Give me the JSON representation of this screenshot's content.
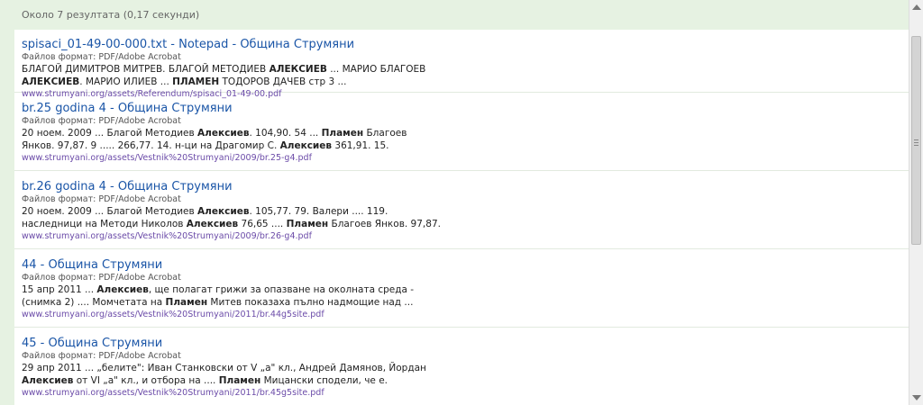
{
  "stats": "Около 7 резултата (0,17 секунди)",
  "results": [
    {
      "title": "spisaci_01-49-00-000.txt - Notepad - Община Струмяни",
      "format": "Файлов формат: PDF/Adobe Acrobat",
      "snippet_lines": [
        [
          {
            "t": "БЛАГОЙ ДИМИТРОВ МИТРЕВ. БЛАГОЙ МЕТОДИЕВ "
          },
          {
            "t": "АЛЕКСИЕВ",
            "b": true
          },
          {
            "t": " ... МАРИО БЛАГОЕВ"
          }
        ],
        [
          {
            "t": "АЛЕКСИЕВ",
            "b": true
          },
          {
            "t": ". МАРИО ИЛИЕВ ... "
          },
          {
            "t": "ПЛАМЕН",
            "b": true
          },
          {
            "t": " ТОДОРОВ ДАЧЕВ стр 3 ..."
          }
        ]
      ],
      "url": "www.strumyani.org/assets/Referendum/spisaci_01-49-00.pdf"
    },
    {
      "title": "br.25 godina 4 - Община Струмяни",
      "format": "Файлов формат: PDF/Adobe Acrobat",
      "snippet_lines": [
        [
          {
            "t": "20 ноем. 2009 ... Благой Методиев "
          },
          {
            "t": "Алексиев",
            "b": true
          },
          {
            "t": ". 104,90. 54 ... "
          },
          {
            "t": "Пламен",
            "b": true
          },
          {
            "t": " Благоев"
          }
        ],
        [
          {
            "t": "Янков. 97,87. 9 ..... 266,77. 14. н-ци на Драгомир С. "
          },
          {
            "t": "Алексиев",
            "b": true
          },
          {
            "t": " 361,91. 15."
          }
        ]
      ],
      "url": "www.strumyani.org/assets/Vestnik%20Strumyani/2009/br.25-g4.pdf"
    },
    {
      "title": "br.26 godina 4 - Община Струмяни",
      "format": "Файлов формат: PDF/Adobe Acrobat",
      "snippet_lines": [
        [
          {
            "t": "20 ноем. 2009 ... Благой Методиев "
          },
          {
            "t": "Алексиев",
            "b": true
          },
          {
            "t": ". 105,77. 79. Валери .... 119."
          }
        ],
        [
          {
            "t": "наследници на Методи Николов "
          },
          {
            "t": "Алексиев",
            "b": true
          },
          {
            "t": " 76,65 .... "
          },
          {
            "t": "Пламен",
            "b": true
          },
          {
            "t": " Благоев Янков. 97,87."
          }
        ]
      ],
      "url": "www.strumyani.org/assets/Vestnik%20Strumyani/2009/br.26-g4.pdf"
    },
    {
      "title": "44 - Община Струмяни",
      "format": "Файлов формат: PDF/Adobe Acrobat",
      "snippet_lines": [
        [
          {
            "t": "15 апр 2011 ... "
          },
          {
            "t": "Алексиев",
            "b": true
          },
          {
            "t": ", ще полагат грижи за опазване на околната среда -"
          }
        ],
        [
          {
            "t": "(снимка 2) .... Момчетата на "
          },
          {
            "t": "Пламен",
            "b": true
          },
          {
            "t": " Митев показаха пълно надмощие над ..."
          }
        ]
      ],
      "url": "www.strumyani.org/assets/Vestnik%20Strumyani/2011/br.44g5site.pdf"
    },
    {
      "title": "45 - Община Струмяни",
      "format": "Файлов формат: PDF/Adobe Acrobat",
      "snippet_lines": [
        [
          {
            "t": "29 апр 2011 ... „белите\": Иван Станковски от V „а\" кл., Андрей Дамянов, Йордан"
          }
        ],
        [
          {
            "t": "Алексиев",
            "b": true
          },
          {
            "t": " от VI „а\" кл., и отбора на .... "
          },
          {
            "t": "Пламен",
            "b": true
          },
          {
            "t": " Мицански сподели, че е."
          }
        ]
      ],
      "url": "www.strumyani.org/assets/Vestnik%20Strumyani/2011/br.45g5site.pdf"
    }
  ]
}
